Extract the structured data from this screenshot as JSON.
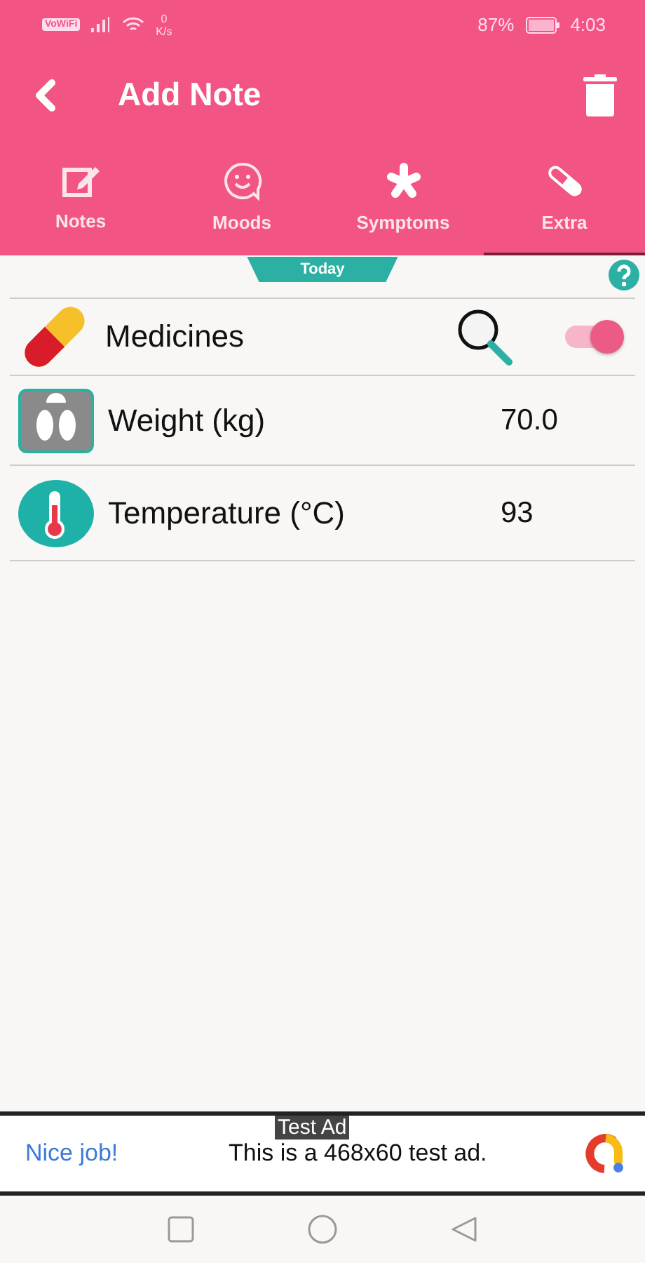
{
  "status_bar": {
    "network_badge": "VoWiFi",
    "speed_value": "0",
    "speed_unit": "K/s",
    "battery": "87%",
    "time": "4:03"
  },
  "header": {
    "title": "Add Note"
  },
  "tabs": [
    {
      "label": "Notes",
      "selected": false
    },
    {
      "label": "Moods",
      "selected": false
    },
    {
      "label": "Symptoms",
      "selected": false
    },
    {
      "label": "Extra",
      "selected": true
    }
  ],
  "date_banner": "Today",
  "rows": [
    {
      "kind": "toggle",
      "label": "Medicines",
      "on": true
    },
    {
      "kind": "value",
      "label": "Weight (kg)",
      "value": "70.0"
    },
    {
      "kind": "value",
      "label": "Temperature (°C)",
      "value": "93"
    }
  ],
  "ad": {
    "badge": "Test Ad",
    "headline": "Nice job!",
    "text": "This is a 468x60 test ad."
  }
}
